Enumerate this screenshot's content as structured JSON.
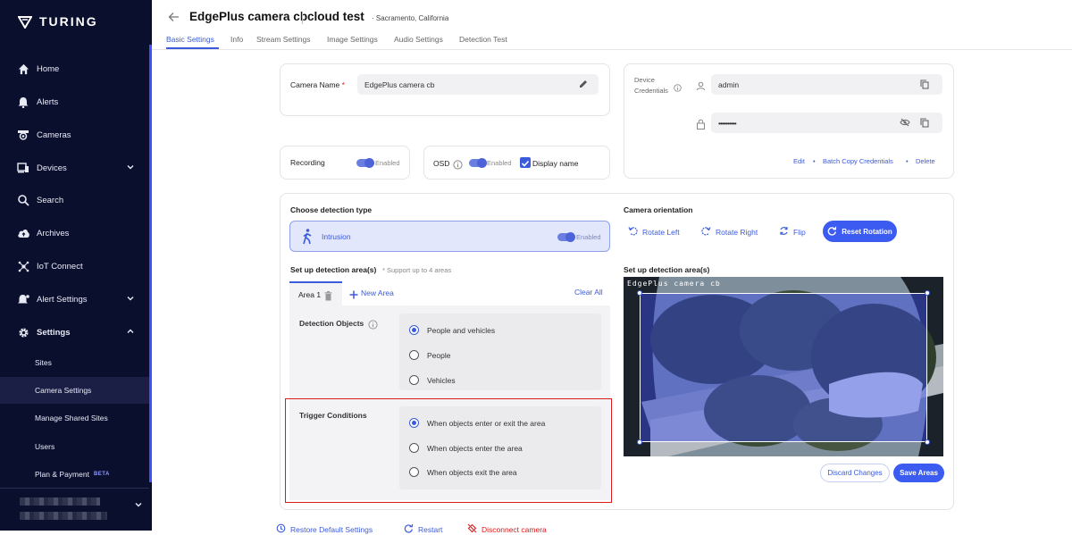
{
  "app": {
    "brand": "TURING"
  },
  "sidebar": {
    "items": [
      {
        "label": "Home",
        "icon": "home-icon"
      },
      {
        "label": "Alerts",
        "icon": "bell-icon"
      },
      {
        "label": "Cameras",
        "icon": "camera-icon"
      },
      {
        "label": "Devices",
        "icon": "devices-icon"
      },
      {
        "label": "Search",
        "icon": "search-icon"
      },
      {
        "label": "Archives",
        "icon": "cloud-upload-icon"
      },
      {
        "label": "IoT Connect",
        "icon": "iot-icon"
      },
      {
        "label": "Alert Settings",
        "icon": "alert-settings-icon"
      },
      {
        "label": "Settings",
        "icon": "gear-icon"
      }
    ],
    "sub_items": [
      {
        "label": "Sites"
      },
      {
        "label": "Camera Settings"
      },
      {
        "label": "Manage Shared Sites"
      },
      {
        "label": "Users"
      },
      {
        "label": "Plan & Payment",
        "badge": "BETA"
      }
    ]
  },
  "header": {
    "title": "EdgePlus camera cb",
    "title2": "cloud test",
    "location": "Sacramento, California",
    "tabs": [
      "Basic Settings",
      "Info",
      "Stream Settings",
      "Image Settings",
      "Audio Settings",
      "Detection Test"
    ]
  },
  "camera": {
    "name_label": "Camera Name",
    "required_mark": "*",
    "name_value": "EdgePlus camera cb"
  },
  "credentials": {
    "label": "Device Credentials",
    "username": "admin",
    "password": "••••••••••",
    "edit": "Edit",
    "batch_copy": "Batch Copy Credentials",
    "delete": "Delete"
  },
  "recording": {
    "label": "Recording",
    "state": "Enabled"
  },
  "osd": {
    "label": "OSD",
    "state": "Enabled",
    "display_name": "Display name"
  },
  "detection": {
    "type_label": "Choose detection type",
    "type_value": "Intrusion",
    "state": "Enabled",
    "areas_label": "Set up detection area(s)",
    "areas_note": "* Support up to 4 areas",
    "area_tab": "Area 1",
    "new_area": "New Area",
    "clear_all": "Clear All",
    "objects_label": "Detection Objects",
    "objects": [
      "People and vehicles",
      "People",
      "Vehicles"
    ],
    "objects_selected": 0,
    "trigger_label": "Trigger Conditions",
    "triggers": [
      "When objects enter or exit the area",
      "When objects enter the area",
      "When objects exit the area"
    ],
    "trigger_selected": 0
  },
  "orientation": {
    "label": "Camera orientation",
    "rotate_left": "Rotate Left",
    "rotate_right": "Rotate Right",
    "flip": "Flip",
    "reset": "Reset Rotation"
  },
  "preview": {
    "label": "Set up detection area(s)",
    "overlay_text": "EdgePlus camera cb",
    "discard": "Discard Changes",
    "save": "Save Areas"
  },
  "footer": {
    "restore": "Restore Default Settings",
    "restart": "Restart",
    "disconnect": "Disconnect camera"
  },
  "colors": {
    "accent": "#3b5bdb",
    "sidebar_bg": "#0b0f2e",
    "highlight": "#d81b1b"
  }
}
